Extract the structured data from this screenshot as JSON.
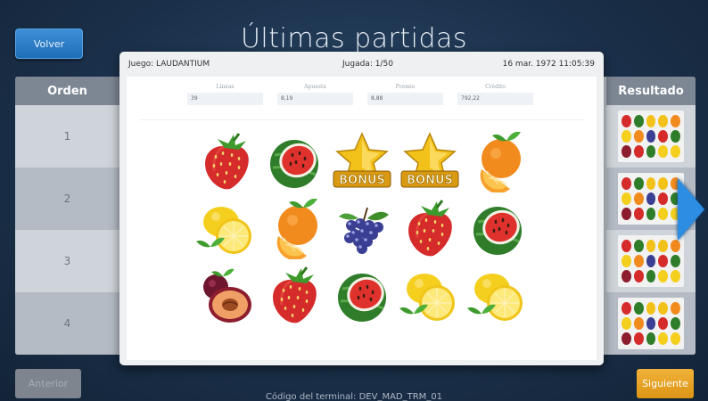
{
  "header": {
    "back_label": "Volver",
    "title": "Últimas partidas"
  },
  "table": {
    "col_order": "Orden",
    "col_result": "Resultado",
    "rows": [
      "1",
      "2",
      "3",
      "4"
    ]
  },
  "modal": {
    "game": "Juego: LAUDANTIUM",
    "play": "Jugada: 1/50",
    "date": "16 mar. 1972 11:05:39",
    "stats": [
      {
        "label": "Líneas",
        "value": "39"
      },
      {
        "label": "Apuesta",
        "value": "8,19"
      },
      {
        "label": "Premio",
        "value": "8,88"
      },
      {
        "label": "Crédito",
        "value": "792,22"
      }
    ],
    "reels": [
      [
        "strawberry-icon",
        "watermelon-icon",
        "bonus-star-icon",
        "bonus-star-icon",
        "orange-icon"
      ],
      [
        "lemon-icon",
        "orange-icon",
        "grapes-icon",
        "strawberry-icon",
        "watermelon-icon"
      ],
      [
        "plum-icon",
        "strawberry-icon",
        "watermelon-icon",
        "lemon-icon",
        "lemon-icon"
      ]
    ],
    "bonus_text": "BONUS"
  },
  "footer": {
    "prev_label": "Anterior",
    "next_label": "Siguiente",
    "terminal": "Código del terminal: DEV_MAD_TRM_01"
  },
  "colors": {
    "accent": "#2d8de2",
    "next_button": "#e8a426",
    "modal_bg": "#eef0f2"
  }
}
